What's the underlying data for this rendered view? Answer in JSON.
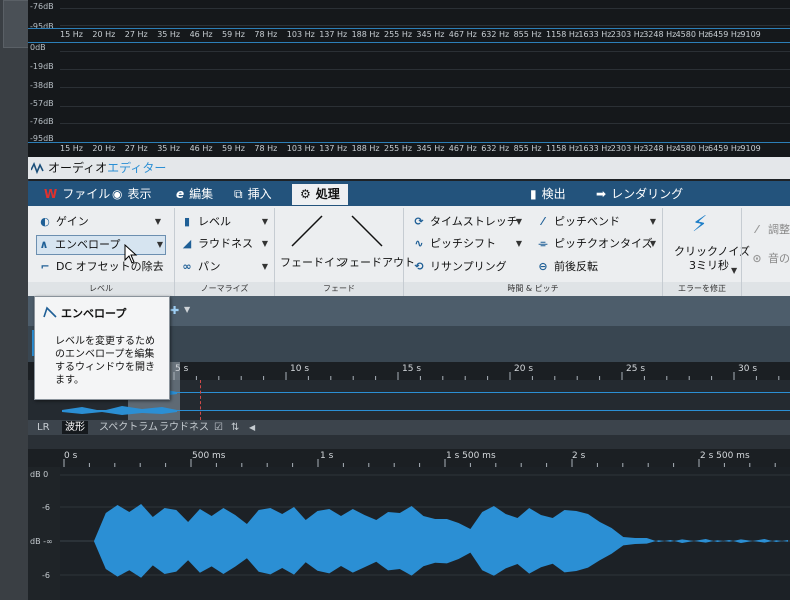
{
  "spectrum_top": {
    "db_labels": [
      "-76dB",
      "-95dB"
    ],
    "freq_labels": [
      "15 Hz",
      "20 Hz",
      "27 Hz",
      "35 Hz",
      "46 Hz",
      "59 Hz",
      "78 Hz",
      "103 Hz",
      "137 Hz",
      "188 Hz",
      "255 Hz",
      "345 Hz",
      "467 Hz",
      "632 Hz",
      "855 Hz",
      "1158 Hz",
      "1633 Hz",
      "2303 Hz",
      "3248 Hz",
      "4580 Hz",
      "6459 Hz",
      "9109"
    ]
  },
  "spectrum_mid": {
    "db_labels": [
      "0dB",
      "-19dB",
      "-38dB",
      "-57dB",
      "-76dB",
      "-95dB"
    ],
    "freq_labels": [
      "15 Hz",
      "20 Hz",
      "27 Hz",
      "35 Hz",
      "46 Hz",
      "59 Hz",
      "78 Hz",
      "103 Hz",
      "137 Hz",
      "188 Hz",
      "255 Hz",
      "345 Hz",
      "467 Hz",
      "632 Hz",
      "855 Hz",
      "1158 Hz",
      "1633 Hz",
      "2303 Hz",
      "3248 Hz",
      "4580 Hz",
      "6459 Hz",
      "9109"
    ]
  },
  "audio_editor": {
    "title_part1": "オーディオ",
    "title_part2": "エディター"
  },
  "tabs": [
    {
      "label": "ファイル"
    },
    {
      "label": "表示"
    },
    {
      "label": "編集"
    },
    {
      "label": "挿入"
    },
    {
      "label": "処理"
    },
    {
      "label": "検出"
    },
    {
      "label": "レンダリング"
    }
  ],
  "ribbon": {
    "level_group": {
      "gain": "ゲイン",
      "envelope": "エンベロープ",
      "dc_offset": "DC オフセットの除去",
      "label": "レベル"
    },
    "normalize_group": {
      "level": "レベル",
      "loudness": "ラウドネス",
      "pan": "パン",
      "label": "ノーマライズ"
    },
    "fade_group": {
      "fade_in": "フェードイン",
      "fade_out": "フェードアウト",
      "label": "フェード"
    },
    "time_pitch_group": {
      "time_stretch": "タイムストレッチ",
      "pitch_shift": "ピッチシフト",
      "resampling": "リサンプリング",
      "pitch_bend": "ピッチベンド",
      "pitch_quantize": "ピッチクオンタイズ",
      "reverse": "前後反転",
      "label": "時間 & ピッチ"
    },
    "error_group": {
      "click_noise": "クリックノイズ",
      "click_ms": "3ミリ秒",
      "label": "エラーを修正"
    },
    "extra_group": {
      "adjust": "調整",
      "sound": "音の"
    }
  },
  "tooltip": {
    "title": "エンベロープ",
    "body": "レベルを変更するためのエンベロープを編集するウィンドウを開きます。"
  },
  "overview_ruler": [
    "5 s",
    "10 s",
    "15 s",
    "20 s",
    "25 s",
    "30 s"
  ],
  "view_tabs": {
    "lr": "LR",
    "waveform": "波形",
    "spectrum": "スペクトラム",
    "loudness": "ラウドネス"
  },
  "main_ruler": [
    "0 s",
    "500 ms",
    "1 s",
    "1 s 500 ms",
    "2 s",
    "2 s 500 ms"
  ],
  "db_markers": [
    "dB 0",
    "-6",
    "dB -∞",
    "-6"
  ],
  "colors": {
    "accent": "#2b8fd4",
    "tab_bar": "#23537c",
    "ribbon": "#eceef0"
  }
}
